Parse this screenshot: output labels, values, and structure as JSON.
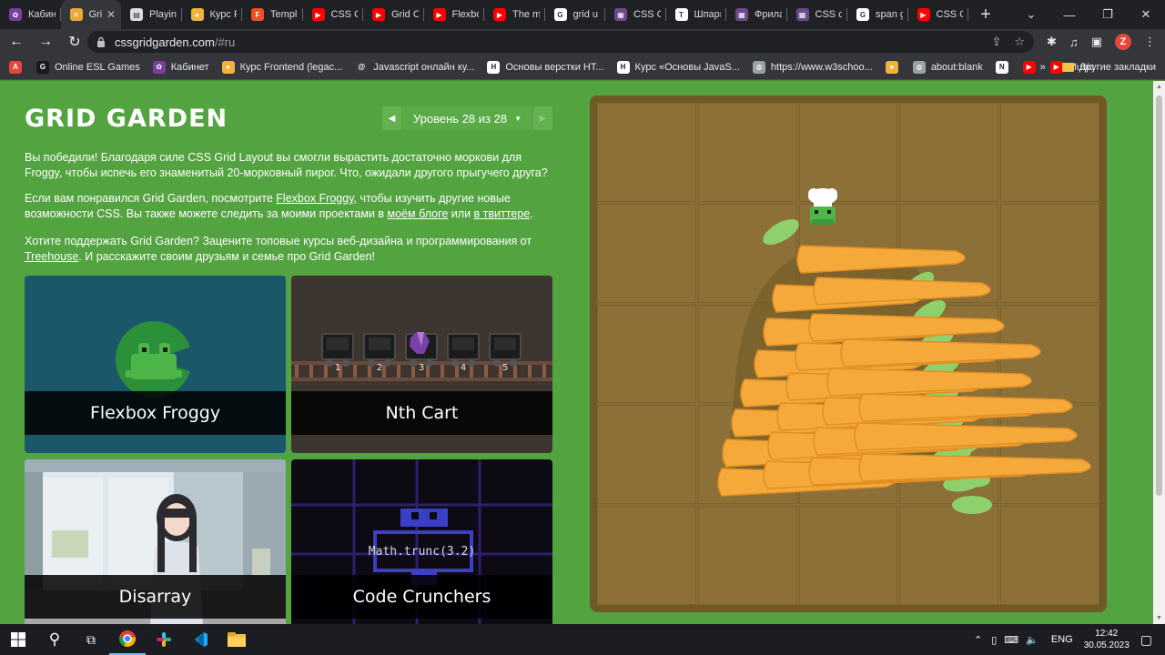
{
  "browser": {
    "tabs": [
      {
        "title": "Кабин",
        "icon": "purple-logo-icon",
        "color": "#7b3fa0",
        "glyph": "✿",
        "active": false
      },
      {
        "title": "Gri",
        "icon": "grid-garden-carrot-icon",
        "color": "#e8a93a",
        "glyph": "✕",
        "active": true
      },
      {
        "title": "Playing",
        "icon": "page-icon",
        "color": "#dcdcdc",
        "glyph": "▤",
        "active": false
      },
      {
        "title": "Курс F",
        "icon": "avatar-icon",
        "color": "#f2b33d",
        "glyph": "●",
        "active": false
      },
      {
        "title": "Templ",
        "icon": "figma-icon",
        "color": "#f24e1e",
        "glyph": "F",
        "active": false
      },
      {
        "title": "CSS G",
        "icon": "youtube-icon",
        "color": "#ff0000",
        "glyph": "▶",
        "active": false
      },
      {
        "title": "Grid C",
        "icon": "youtube-icon",
        "color": "#ff0000",
        "glyph": "▶",
        "active": false
      },
      {
        "title": "Flexbo",
        "icon": "youtube-icon",
        "color": "#ff0000",
        "glyph": "▶",
        "active": false
      },
      {
        "title": "The m",
        "icon": "youtube-icon",
        "color": "#ff0000",
        "glyph": "▶",
        "active": false
      },
      {
        "title": "grid u",
        "icon": "google-icon",
        "color": "#ffffff",
        "glyph": "G",
        "active": false
      },
      {
        "title": "CSS G",
        "icon": "purple-logo-icon",
        "color": "#6b4a8c",
        "glyph": "▦",
        "active": false
      },
      {
        "title": "Шпарг",
        "icon": "tb-logo-icon",
        "color": "#ffffff",
        "glyph": "T",
        "active": false
      },
      {
        "title": "Фрила",
        "icon": "purple-logo-icon",
        "color": "#6b4a8c",
        "glyph": "▦",
        "active": false
      },
      {
        "title": "CSS сe",
        "icon": "purple-logo-icon",
        "color": "#6b4a8c",
        "glyph": "▦",
        "active": false
      },
      {
        "title": "span g",
        "icon": "google-icon",
        "color": "#ffffff",
        "glyph": "G",
        "active": false
      },
      {
        "title": "CSS G",
        "icon": "youtube-icon",
        "color": "#ff0000",
        "glyph": "▶",
        "active": false
      }
    ],
    "url_host": "cssgridgarden.com",
    "url_rest": "/#ru",
    "profile_initial": "Z",
    "bookmarks": [
      {
        "label": "",
        "icon": "apps-icon",
        "color": "#e8453c",
        "glyph": "A"
      },
      {
        "label": "Online ESL Games",
        "icon": "g-icon",
        "color": "#1a1a1a",
        "glyph": "G"
      },
      {
        "label": "Кабинет",
        "icon": "purple-logo-icon",
        "color": "#7b3fa0",
        "glyph": "✿"
      },
      {
        "label": "Курс Frontend (legac...",
        "icon": "avatar-icon",
        "color": "#f2b33d",
        "glyph": "●"
      },
      {
        "label": "Javascript онлайн ку...",
        "icon": "at-icon",
        "color": "#3a3a3a",
        "glyph": "@"
      },
      {
        "label": "Основы верстки НТ...",
        "icon": "h-logo-icon",
        "color": "#ffffff",
        "glyph": "H"
      },
      {
        "label": "Курс «Основы JavaS...",
        "icon": "h-logo-icon",
        "color": "#ffffff",
        "glyph": "H"
      },
      {
        "label": "https://www.w3schoo...",
        "icon": "globe-icon",
        "color": "#9aa0a6",
        "glyph": "◍"
      },
      {
        "label": "",
        "icon": "coin-icon",
        "color": "#f2b33d",
        "glyph": "●"
      },
      {
        "label": "about:blank",
        "icon": "globe-icon",
        "color": "#9aa0a6",
        "glyph": "◍"
      },
      {
        "label": "",
        "icon": "notion-icon",
        "color": "#ffffff",
        "glyph": "N"
      },
      {
        "label": "",
        "icon": "youtube-icon",
        "color": "#ff0000",
        "glyph": "▶"
      },
      {
        "label": "Music",
        "icon": "youtube-icon",
        "color": "#ff0000",
        "glyph": "▶"
      }
    ],
    "more_bookmarks": "»",
    "other_bookmarks": "Другие закладки"
  },
  "page": {
    "title": "GRID GARDEN",
    "level_text": "Уровень 28 из 28",
    "level_caret": "▼",
    "paragraph1": "Вы победили! Благодаря силе CSS Grid Layout вы смогли вырастить достаточно моркови для Froggy, чтобы испечь его знаменитый 20-морковный пирог. Что, ожидали другого прыгучего друга?",
    "p2_before": "Если вам понравился Grid Garden, посмотрите ",
    "p2_link1": "Flexbox Froggy",
    "p2_middle": ", чтобы изучить другие новые возможности CSS. Вы также можете следить за моими проектами в ",
    "p2_link2": "моём блоге",
    "p2_or": " или ",
    "p2_link3": "в твиттере",
    "p2_end": ".",
    "p3_before": "Хотите поддержать Grid Garden? Зацените топовые курсы веб-дизайна и программирования от ",
    "p3_link": "Treehouse",
    "p3_end": ". И расскажите своим друзьям и семье про Grid Garden!",
    "cards": [
      {
        "label": "Flexbox Froggy"
      },
      {
        "label": "Nth Cart"
      },
      {
        "label": "Disarray"
      },
      {
        "label": "Code Crunchers",
        "code": "Math.trunc(3.2)"
      }
    ],
    "cart_numbers": [
      "1",
      "2",
      "3",
      "4",
      "5"
    ]
  },
  "taskbar": {
    "lang": "ENG",
    "time": "12:42",
    "date": "30.05.2023"
  }
}
